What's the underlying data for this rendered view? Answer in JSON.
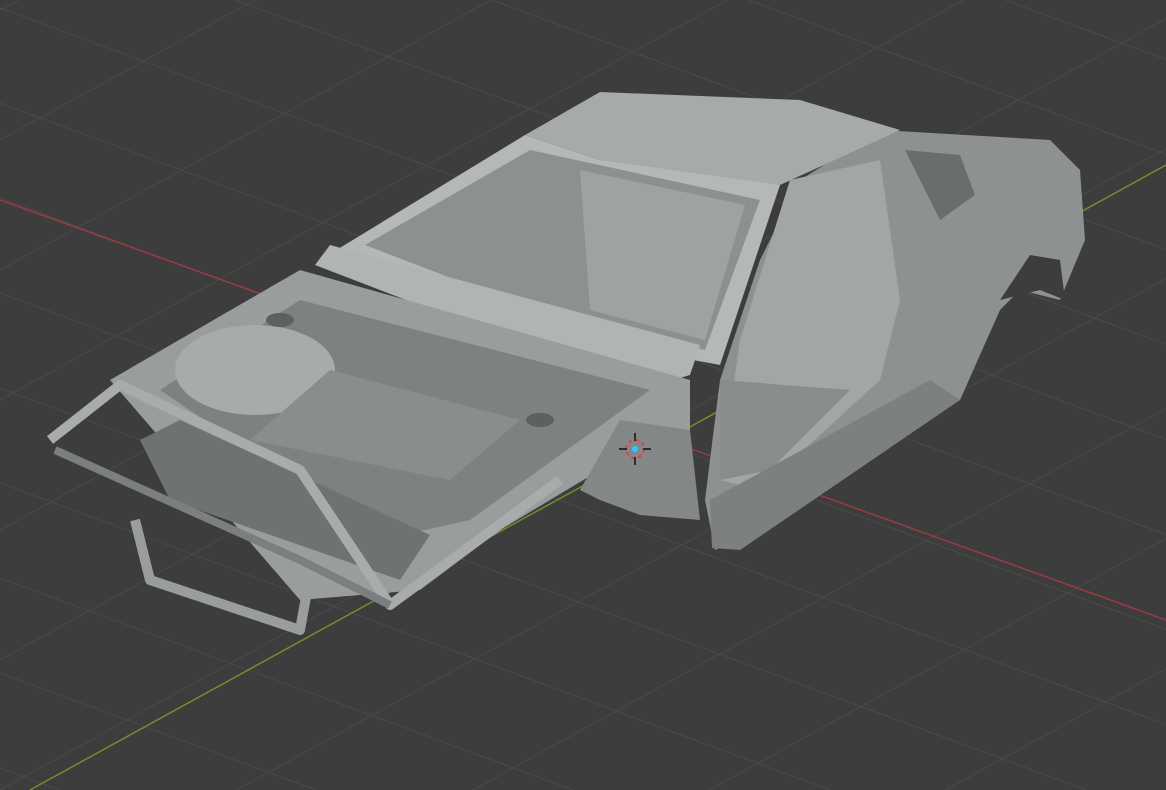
{
  "viewport": {
    "mode": "3D Viewport",
    "colors": {
      "background": "#3d3d3d",
      "grid": "#4a4a4a",
      "x_axis": "#9a3a45",
      "y_axis": "#6e8f2c",
      "model_light": "#b9bcbc",
      "model_mid": "#959898",
      "model_dark": "#6f7272",
      "cursor_center": "#33c3ff",
      "cursor_ring": "#e04040"
    },
    "icons": [
      "3d-cursor-icon"
    ]
  }
}
